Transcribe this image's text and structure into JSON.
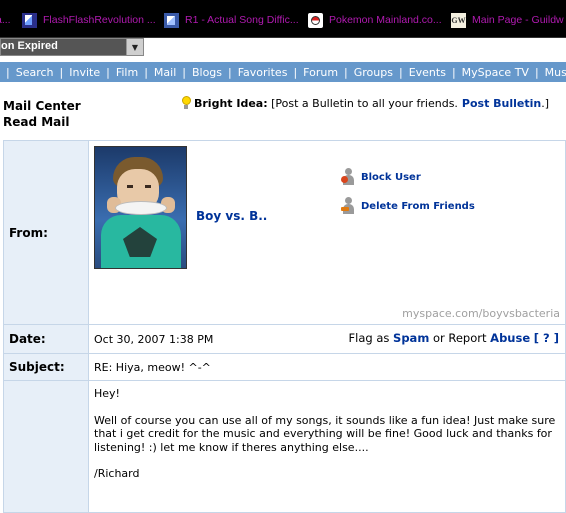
{
  "browser_tabs": [
    {
      "label": "a...",
      "icon": "ffr-icon"
    },
    {
      "label": "FlashFlashRevolution ...",
      "icon": "ffr-icon"
    },
    {
      "label": "R1 - Actual Song Diffic...",
      "icon": "r1-icon"
    },
    {
      "label": "Pokemon Mainland.co...",
      "icon": "pokeball-icon"
    },
    {
      "label": "Main Page - Guildw",
      "icon": "gw-icon"
    }
  ],
  "session_select": {
    "value": "on Expired"
  },
  "nav": {
    "items": [
      "Search",
      "Invite",
      "Film",
      "Mail",
      "Blogs",
      "Favorites",
      "Forum",
      "Groups",
      "Events",
      "MySpace TV",
      "Music"
    ]
  },
  "mail": {
    "center_label": "Mail Center",
    "read_label": "Read Mail"
  },
  "bright_idea": {
    "label": "Bright Idea:",
    "text": "[Post a Bulletin to all your friends.",
    "link": "Post Bulletin",
    "end": ".]"
  },
  "message": {
    "from_label": "From:",
    "sender_name": "Boy vs. B..",
    "block_user": "Block User",
    "delete_friend": "Delete From Friends",
    "profile_url": "myspace.com/boyvsbacteria",
    "date_label": "Date:",
    "date_value": "Oct 30, 2007 1:38 PM",
    "flag_text": "Flag as",
    "spam_link": "Spam",
    "or_report": "or Report",
    "abuse_link": "Abuse",
    "help_link": "[ ? ]",
    "subject_label": "Subject:",
    "subject_value": "RE: Hiya, meow! ^-^",
    "body_greeting": "Hey!",
    "body_main": "Well of course you can use all of my songs, it sounds like a fun idea! Just make sure that i get credit for the music and everything will be fine! Good luck and thanks for listening! :) let me know if theres anything else....",
    "body_sign": "/Richard"
  },
  "colors": {
    "nav_bg": "#6698cb",
    "label_bg": "#e7eff8",
    "link": "#003399",
    "tab_text": "#b01ab0"
  }
}
